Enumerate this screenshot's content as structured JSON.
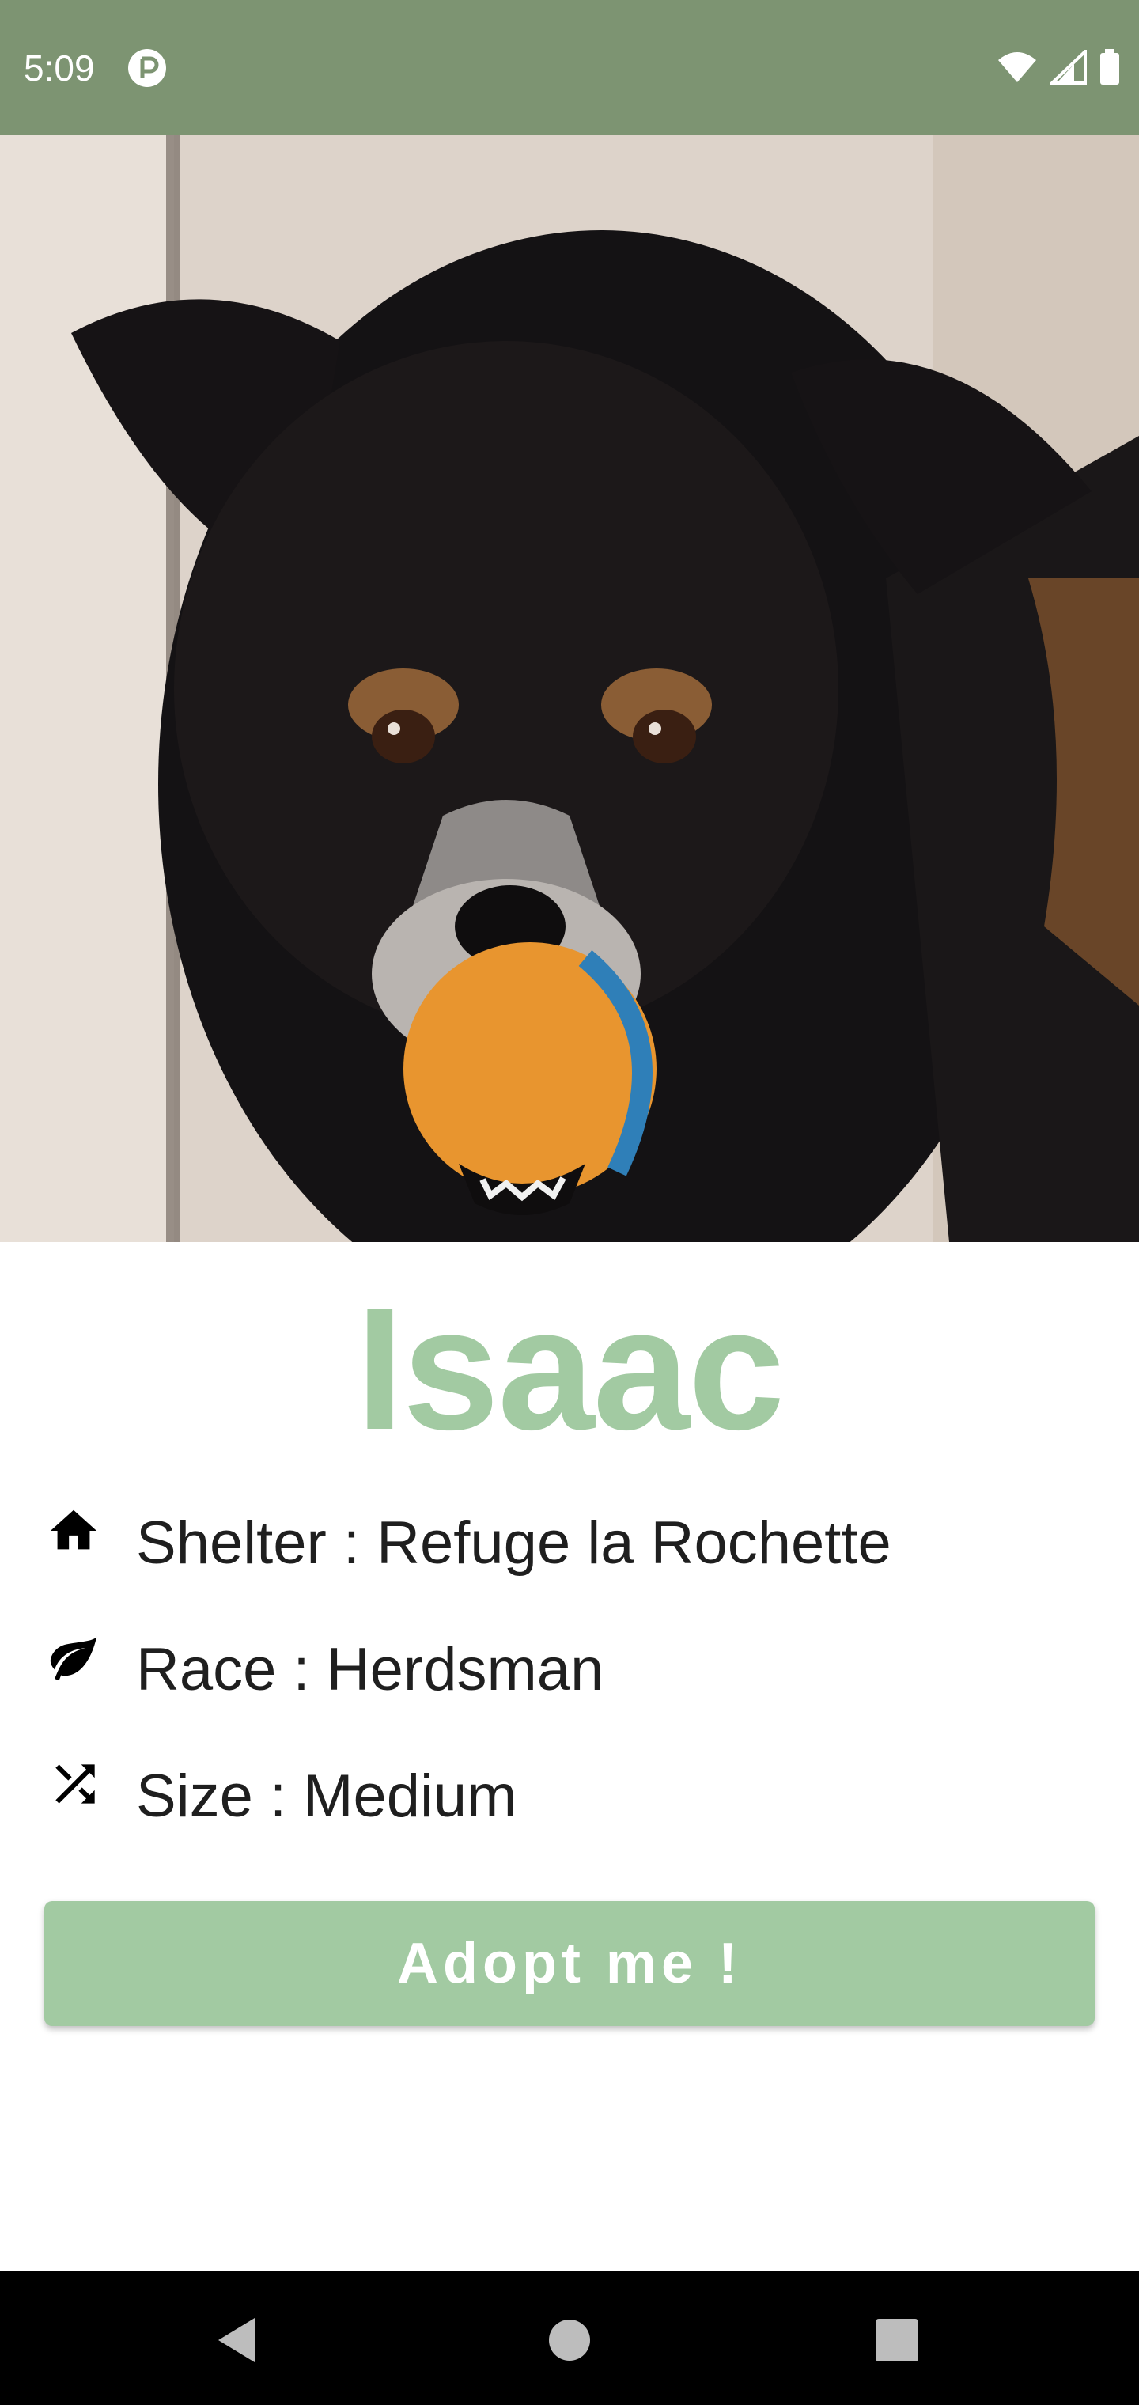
{
  "status_bar": {
    "time": "5:09",
    "app_icon": "private-dns-icon",
    "icons": [
      "wifi-icon",
      "cell-signal-icon",
      "battery-icon"
    ]
  },
  "hero": {
    "alt": "Photo of a black and tan dog holding an orange ball"
  },
  "pet": {
    "name": "Isaac",
    "details": [
      {
        "icon": "home-icon",
        "text": "Shelter : Refuge la Rochette"
      },
      {
        "icon": "leaf-icon",
        "text": "Race : Herdsman"
      },
      {
        "icon": "shuffle-icon",
        "text": "Size : Medium"
      }
    ]
  },
  "actions": {
    "adopt_label": "Adopt me !"
  },
  "nav": {
    "buttons": [
      "back-icon",
      "home-circle-icon",
      "recents-icon"
    ]
  },
  "colors": {
    "status_bar": "#7d9472",
    "accent": "#a2caa2",
    "text": "#1f1f1f",
    "nav_bar": "#000000"
  }
}
